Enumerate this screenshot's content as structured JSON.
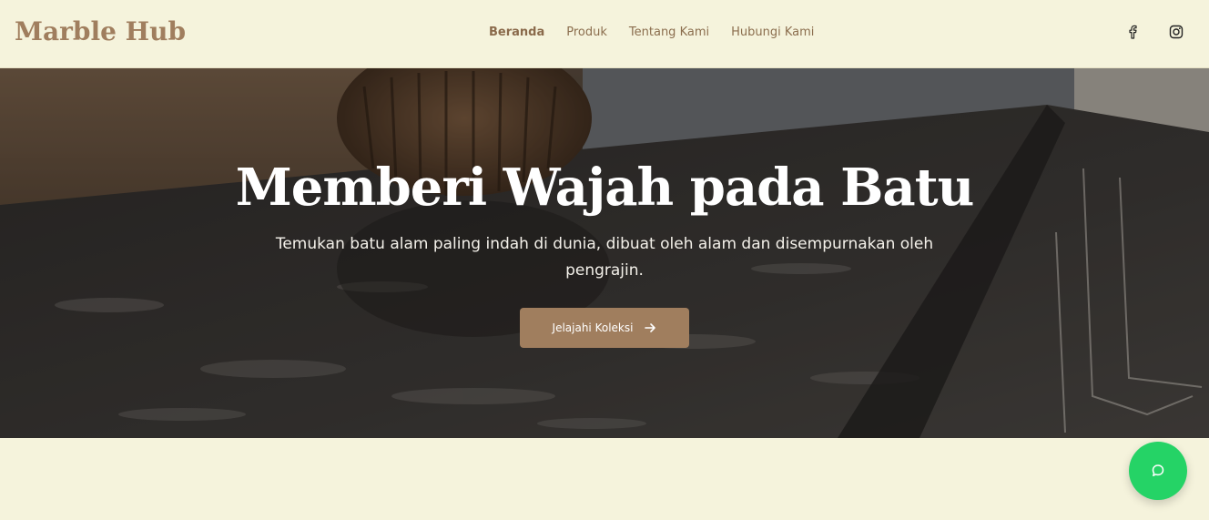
{
  "header": {
    "logo": "Marble Hub",
    "nav": [
      {
        "label": "Beranda",
        "active": true
      },
      {
        "label": "Produk",
        "active": false
      },
      {
        "label": "Tentang Kami",
        "active": false
      },
      {
        "label": "Hubungi Kami",
        "active": false
      }
    ],
    "social": [
      {
        "icon": "facebook-icon"
      },
      {
        "icon": "instagram-icon"
      }
    ]
  },
  "hero": {
    "title": "Memberi Wajah pada Batu",
    "subtitle": "Temukan batu alam paling indah di dunia, dibuat oleh alam dan disempurnakan oleh pengrajin.",
    "cta_label": "Jelajahi Koleksi",
    "cta_icon": "arrow-right-icon"
  },
  "chat": {
    "icon": "chat-bubble-icon"
  },
  "colors": {
    "background": "#f5f3dc",
    "accent": "#a07e5e",
    "chat": "#25d366"
  }
}
